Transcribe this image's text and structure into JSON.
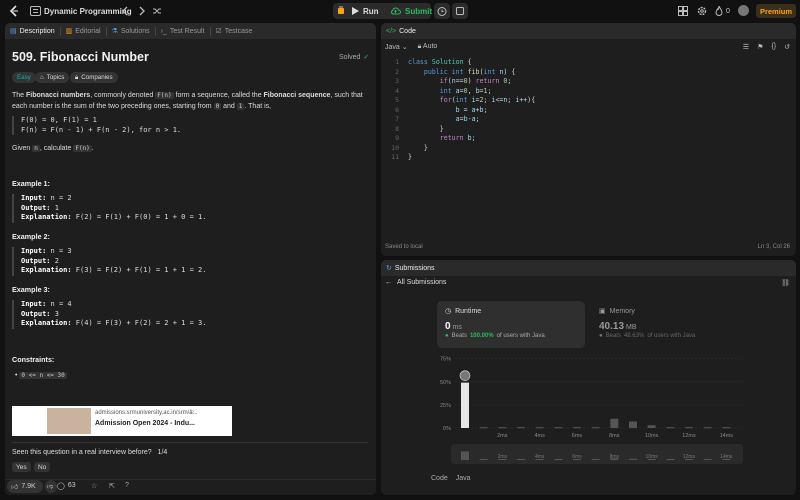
{
  "topbar": {
    "title": "Dynamic Programming",
    "run_label": "Run",
    "submit_label": "Submit",
    "streak": "0",
    "premium_label": "Premium"
  },
  "left_tabs": [
    {
      "label": "Description",
      "icon": "description-icon"
    },
    {
      "label": "Editorial",
      "icon": "book-icon"
    },
    {
      "label": "Solutions",
      "icon": "flask-icon"
    },
    {
      "label": "Test Result",
      "icon": "terminal-icon"
    },
    {
      "label": "Testcase",
      "icon": "checkbox-icon"
    }
  ],
  "problem": {
    "title": "509. Fibonacci Number",
    "status": "Solved",
    "difficulty": "Easy",
    "topics_label": "Topics",
    "companies_label": "Companies",
    "desc_1": "The ",
    "desc_bold_1": "Fibonacci numbers",
    "desc_2": ", commonly denoted ",
    "desc_code_1": "F(n)",
    "desc_3": " form a sequence, called the ",
    "desc_bold_2": "Fibonacci sequence",
    "desc_4": ", such that each number is the sum of the two preceding ones, starting from ",
    "desc_code_2": "0",
    "desc_5": " and ",
    "desc_code_3": "1",
    "desc_6": ". That is,",
    "formula": "F(0) = 0, F(1) = 1\nF(n) = F(n - 1) + F(n - 2), for n > 1.",
    "given_1": "Given ",
    "given_code_1": "n",
    "given_2": ", calculate ",
    "given_code_2": "F(n)",
    "given_3": ".",
    "examples": [
      {
        "title": "Example 1:",
        "input": "n = 2",
        "output": "1",
        "explanation": "F(2) = F(1) + F(0) = 1 + 0 = 1."
      },
      {
        "title": "Example 2:",
        "input": "n = 3",
        "output": "2",
        "explanation": "F(3) = F(2) + F(1) = 1 + 1 = 2."
      },
      {
        "title": "Example 3:",
        "input": "n = 4",
        "output": "3",
        "explanation": "F(4) = F(3) + F(2) = 2 + 1 = 3."
      }
    ],
    "input_label": "Input:",
    "output_label": "Output:",
    "explanation_label": "Explanation:",
    "constraints_title": "Constraints:",
    "constraint": "0 <= n <= 30",
    "ad_url": "admissions.srmuniversity.ac.in/srm/a...",
    "ad_title": "Admission Open 2024 - Indu...",
    "interview_q": "Seen this question in a real interview before?",
    "interview_count": "1/4",
    "yes": "Yes",
    "no": "No",
    "likes": "7.9K",
    "comments": "63"
  },
  "code_panel": {
    "title": "Code",
    "language": "Java",
    "auto": "Auto",
    "saved": "Saved to local",
    "cursor": "Ln 3, Col 26",
    "lines": [
      "1",
      "2",
      "3",
      "4",
      "5",
      "6",
      "7",
      "8",
      "9",
      "10",
      "11"
    ]
  },
  "submissions": {
    "title": "Submissions",
    "back_label": "All Submissions",
    "runtime_label": "Runtime",
    "runtime_value": "0",
    "runtime_unit": "ms",
    "runtime_beats_prefix": "Beats",
    "runtime_beats": "100.00%",
    "runtime_beats_suffix": "of users with Java",
    "memory_label": "Memory",
    "memory_value": "40.13",
    "memory_unit": "MB",
    "memory_beats_prefix": "Beats",
    "memory_beats": "48.63%",
    "memory_beats_suffix": "of users with Java",
    "code_label": "Code",
    "code_lang": "Java"
  },
  "chart_data": {
    "type": "bar",
    "y_ticks": [
      "75%",
      "50%",
      "25%",
      "0%"
    ],
    "ylim": [
      0,
      80
    ],
    "x_ticks": [
      "2ms",
      "4ms",
      "6ms",
      "8ms",
      "10ms",
      "12ms",
      "14ms"
    ],
    "x": [
      0,
      1,
      2,
      3,
      4,
      5,
      6,
      7,
      8,
      9,
      10,
      11,
      12,
      13,
      14
    ],
    "values": [
      49,
      1,
      1,
      1,
      1,
      1,
      1,
      1,
      10,
      7,
      3,
      1,
      1,
      1,
      1
    ],
    "highlight_index": 0,
    "colors": {
      "highlight": "#e6e6e6",
      "bar": "#555555"
    }
  }
}
